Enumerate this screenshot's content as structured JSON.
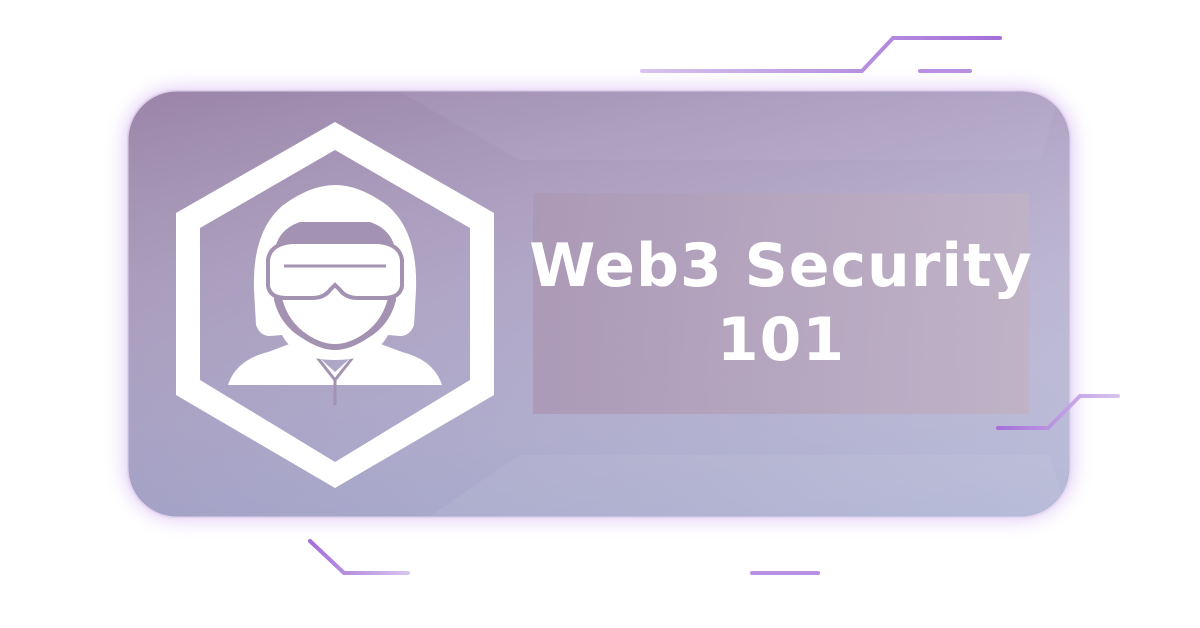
{
  "banner": {
    "title_line1": "Web3 Security",
    "title_line2": "101"
  },
  "icon": {
    "name": "security-agent-hexagon-icon"
  },
  "colors": {
    "accent": "#a472d6",
    "accent_light": "#d8c2ef",
    "panel_start": "#9d86a8",
    "panel_end": "#c8c6dd",
    "title_plate": "#b4a2bd",
    "icon_white": "#ffffff"
  }
}
